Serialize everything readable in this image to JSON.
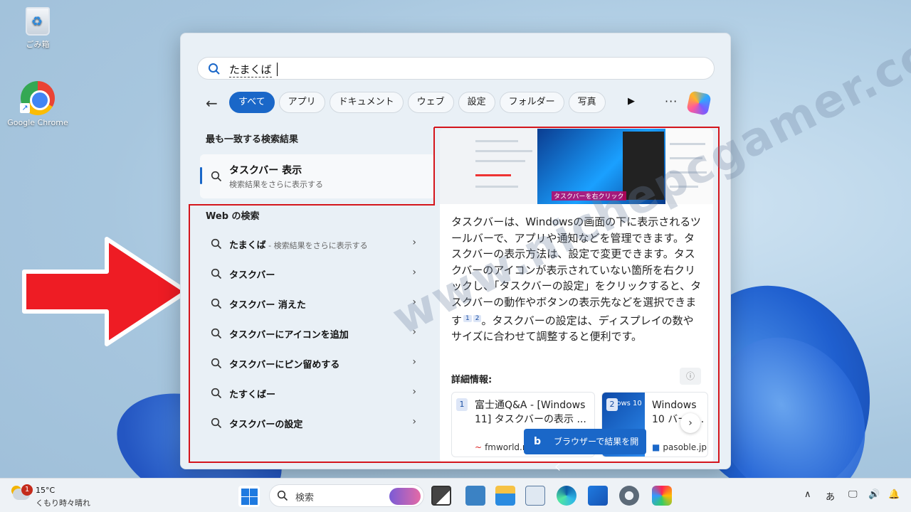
{
  "desktop": {
    "icons": [
      {
        "label": "ごみ箱",
        "icon": "recycle-bin-icon"
      },
      {
        "label": "Google Chrome",
        "icon": "chrome-icon"
      }
    ],
    "watermark": "www.nichepcgamer.com"
  },
  "search": {
    "query": "たまくば",
    "filters": [
      "すべて",
      "アプリ",
      "ドキュメント",
      "ウェブ",
      "設定",
      "フォルダー",
      "写真"
    ],
    "active_filter": "すべて",
    "more_label": "···",
    "best_match": {
      "heading": "最も一致する検索結果",
      "title": "タスクバー 表示",
      "subtitle": "検索結果をさらに表示する"
    },
    "web": {
      "heading": "Web の検索",
      "items": [
        {
          "label": "たまくば",
          "sub": " - 検索結果をさらに表示する"
        },
        {
          "label": "タスクバー",
          "sub": ""
        },
        {
          "label": "タスクバー 消えた",
          "sub": ""
        },
        {
          "label": "タスクバーにアイコンを追加",
          "sub": ""
        },
        {
          "label": "タスクバーにピン留めする",
          "sub": ""
        },
        {
          "label": "たすくばー",
          "sub": ""
        },
        {
          "label": "タスクバーの設定",
          "sub": ""
        }
      ]
    },
    "detail": {
      "thumb_caption": "タスクバーを右クリック",
      "desc_1": "タスクバーは、Windowsの画面の下に表示されるツールバーで、アプリや通知などを管理できます。タスクバーの表示方法は、設定で変更できます。タスクバーのアイコンが表示されていない箇所を右クリックし、「タスクバーの設定」をクリックすると、タスクバーの動作やボタンの表示先などを選択できます",
      "ref1": "1",
      "ref2": "2",
      "desc_2": "。タスクバーの設定は、ディスプレイの数やサイズに合わせて調整すると便利です。",
      "more_heading": "詳細情報:",
      "sources": [
        {
          "num": "1",
          "title": "富士通Q&A - [Windows 11] タスクバーの表示 ...",
          "site": "fmworld.n"
        },
        {
          "num": "2",
          "title": "Windows 10 バーの..",
          "site": "pasoble.jp",
          "thumb_text": "dows 10"
        }
      ],
      "open_button": "ブラウザーで結果を開く",
      "open_button_glyph": "b"
    }
  },
  "taskbar": {
    "weather": {
      "temp": "15°C",
      "condition": "くもり時々晴れ",
      "badge": "1"
    },
    "search_placeholder": "検索",
    "ime": "あ"
  }
}
